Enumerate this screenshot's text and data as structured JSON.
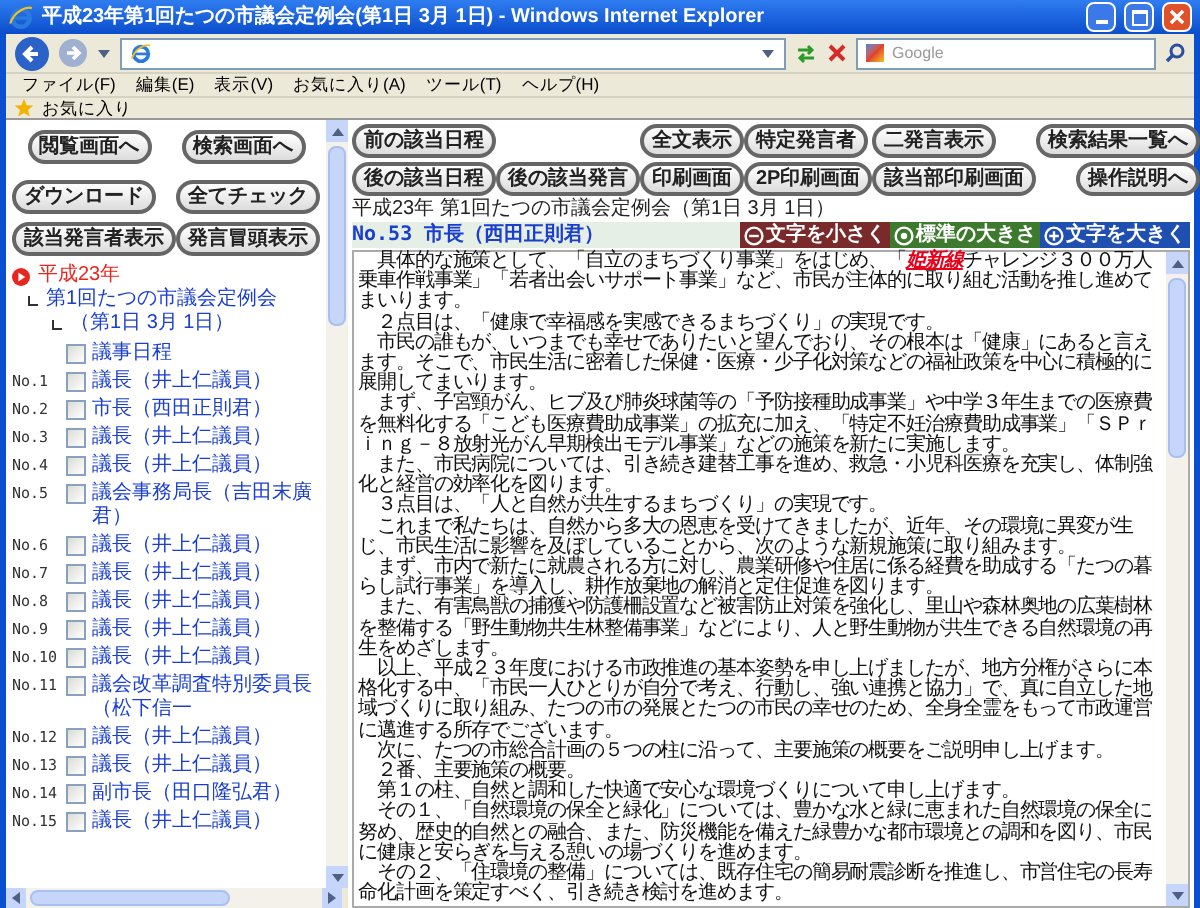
{
  "window": {
    "title": "平成23年第1回たつの市議会定例会(第1日 3月 1日) - Windows Internet Explorer"
  },
  "search": {
    "placeholder": "Google"
  },
  "menu": [
    "ファイル(F)",
    "編集(E)",
    "表示(V)",
    "お気に入り(A)",
    "ツール(T)",
    "ヘルプ(H)"
  ],
  "favorites_bar": {
    "label": "お気に入り"
  },
  "left_panel": {
    "button_rows": [
      [
        "閲覧画面へ",
        "検索画面へ"
      ],
      [
        "ダウンロード",
        "全てチェック"
      ],
      [
        "該当発言者表示",
        "発言冒頭表示"
      ]
    ],
    "tree": {
      "label": "平成23年",
      "children": [
        {
          "label": "第1回たつの市議会定例会",
          "children": [
            {
              "label": "（第1日 3月 1日）"
            }
          ]
        }
      ]
    },
    "speeches": [
      {
        "label": "議事日程",
        "checked": false
      },
      {
        "number": "No.1",
        "label": "議長（井上仁議員）",
        "checked": false
      },
      {
        "number": "No.2",
        "label": "市長（西田正則君）",
        "checked": false
      },
      {
        "number": "No.3",
        "label": "議長（井上仁議員）",
        "checked": false
      },
      {
        "number": "No.4",
        "label": "議長（井上仁議員）",
        "checked": false
      },
      {
        "number": "No.5",
        "label": "議会事務局長（吉田末廣君）",
        "checked": false
      },
      {
        "number": "No.6",
        "label": "議長（井上仁議員）",
        "checked": false
      },
      {
        "number": "No.7",
        "label": "議長（井上仁議員）",
        "checked": false
      },
      {
        "number": "No.8",
        "label": "議長（井上仁議員）",
        "checked": false
      },
      {
        "number": "No.9",
        "label": "議長（井上仁議員）",
        "checked": false
      },
      {
        "number": "No.10",
        "label": "議長（井上仁議員）",
        "checked": false
      },
      {
        "number": "No.11",
        "label": "議会改革調査特別委員長（松下信一",
        "checked": false
      },
      {
        "number": "No.12",
        "label": "議長（井上仁議員）",
        "checked": false
      },
      {
        "number": "No.13",
        "label": "議長（井上仁議員）",
        "checked": false
      },
      {
        "number": "No.14",
        "label": "副市長（田口隆弘君）",
        "checked": false
      },
      {
        "number": "No.15",
        "label": "議長（井上仁議員）",
        "checked": false
      }
    ]
  },
  "right_panel": {
    "button_rows": [
      [
        "前の該当日程",
        "全文表示",
        "特定発言者",
        "二発言表示",
        "検索結果一覧へ"
      ],
      [
        "後の該当日程",
        "後の該当発言",
        "印刷画面",
        "2P印刷画面",
        "該当部印刷画面",
        "操作説明へ"
      ]
    ],
    "session_title": "平成23年 第1回たつの市議会定例会（第1日 3月 1日）",
    "speech_header": "No.53 市長（西田正則君）",
    "font_buttons": [
      {
        "kind": "smaller",
        "label": "文字を小さく"
      },
      {
        "kind": "standard",
        "label": "標準の大きさ"
      },
      {
        "kind": "larger",
        "label": "文字を大きく"
      }
    ],
    "paragraphs": [
      [
        {
          "text": "　具体的な施策として、「自立のまちづくり事業」をはじめ、「",
          "highlight": false
        },
        {
          "text": "姫新線",
          "highlight": true
        },
        {
          "text": "チャレンジ３００万人乗車作戦事業」「若者出会いサポート事業」など、市民が主体的に取り組む活動を推し進めてまいります。",
          "highlight": false
        }
      ],
      [
        {
          "text": "　２点目は、「健康で幸福感を実感できるまちづくり」の実現です。",
          "highlight": false
        }
      ],
      [
        {
          "text": "　市民の誰もが、いつまでも幸せでありたいと望んでおり、その根本は「健康」にあると言えます。そこで、市民生活に密着した保健・医療・少子化対策などの福祉政策を中心に積極的に展開してまいります。",
          "highlight": false
        }
      ],
      [
        {
          "text": "　まず、子宮頸がん、ヒブ及び肺炎球菌等の「予防接種助成事業」や中学３年生までの医療費を無料化する「こども医療費助成事業」の拡充に加え、「特定不妊治療費助成事業」「ＳＰｒｉｎｇ－８放射光がん早期検出モデル事業」などの施策を新たに実施します。",
          "highlight": false
        }
      ],
      [
        {
          "text": "　また、市民病院については、引き続き建替工事を進め、救急・小児科医療を充実し、体制強化と経営の効率化を図ります。",
          "highlight": false
        }
      ],
      [
        {
          "text": "　３点目は、「人と自然が共生するまちづくり」の実現です。",
          "highlight": false
        }
      ],
      [
        {
          "text": "　これまで私たちは、自然から多大の恩恵を受けてきましたが、近年、その環境に異変が生じ、市民生活に影響を及ぼしていることから、次のような新規施策に取り組みます。",
          "highlight": false
        }
      ],
      [
        {
          "text": "　まず、市内で新たに就農される方に対し、農業研修や住居に係る経費を助成する「たつの暮らし試行事業」を導入し、耕作放棄地の解消と定住促進を図ります。",
          "highlight": false
        }
      ],
      [
        {
          "text": "　また、有害鳥獣の捕獲や防護柵設置など被害防止対策を強化し、里山や森林奥地の広葉樹林を整備する「野生動物共生林整備事業」などにより、人と野生動物が共生できる自然環境の再生をめざします。",
          "highlight": false
        }
      ],
      [
        {
          "text": "　以上、平成２３年度における市政推進の基本姿勢を申し上げましたが、地方分権がさらに本格化する中、「市民一人ひとりが自分で考え、行動し、強い連携と協力」で、真に自立した地域づくりに取り組み、たつの市の発展とたつの市民の幸せのため、全身全霊をもって市政運営に邁進する所存でございます。",
          "highlight": false
        }
      ],
      [
        {
          "text": "　次に、たつの市総合計画の５つの柱に沿って、主要施策の概要をご説明申し上げます。",
          "highlight": false
        }
      ],
      [
        {
          "text": "　２番、主要施策の概要。",
          "highlight": false
        }
      ],
      [
        {
          "text": "　第１の柱、自然と調和した快適で安心な環境づくりについて申し上げます。",
          "highlight": false
        }
      ],
      [
        {
          "text": "　その１、「自然環境の保全と緑化」については、豊かな水と緑に恵まれた自然環境の保全に努め、歴史的自然との融合、また、防災機能を備えた緑豊かな都市環境との調和を図り、市民に健康と安らぎを与える憩いの場づくりを進めます。",
          "highlight": false
        }
      ],
      [
        {
          "text": "　その２、「住環境の整備」については、既存住宅の簡易耐震診断を推進し、市営住宅の長寿命化計画を策定すべく、引き続き検討を進めます。",
          "highlight": false
        }
      ]
    ]
  }
}
